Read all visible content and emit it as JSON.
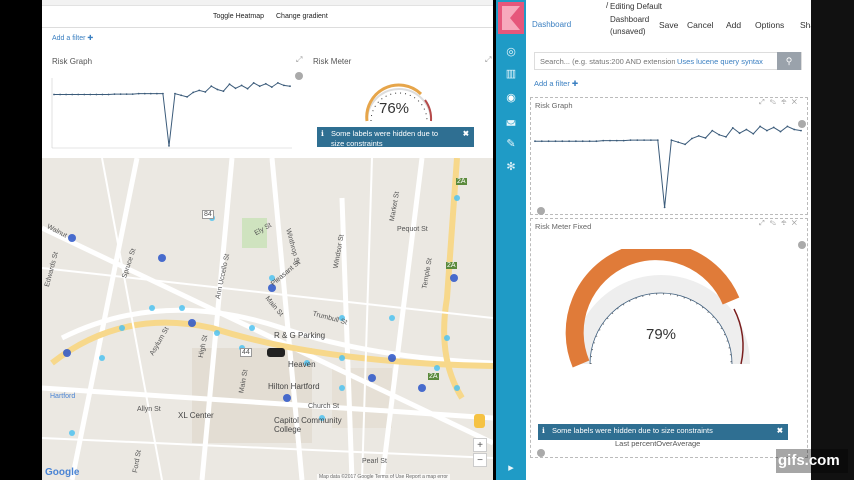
{
  "left_window": {
    "toolbar": {
      "toggle_heatmap": "Toggle Heatmap",
      "change_gradient": "Change gradient"
    },
    "filter_link": "Add a filter ✚",
    "risk_graph_title": "Risk Graph",
    "risk_meter_title": "Risk Meter",
    "risk_meter_value": "76%",
    "risk_meter_level": 0.76,
    "toast": {
      "icon": "ℹ",
      "text": "Some labels were hidden due to size constraints",
      "close": "✖"
    },
    "map": {
      "labels": [
        "Walnut",
        "Edwards St",
        "Ely St",
        "Pleasant St",
        "Main St",
        "Winthrop St",
        "Windsor St",
        "Market St",
        "Pequot St",
        "Trumbull St",
        "R & G Parking",
        "Heaven",
        "Hilton Hartford",
        "Hartford",
        "Allyn St",
        "XL Center",
        "Church St",
        "Capitol Community College",
        "Pearl St",
        "Ford St",
        "Temple St",
        "High St",
        "Ann Uccello St",
        "Asylum St",
        "Spruce St",
        "Main St"
      ],
      "route_shields": [
        "84",
        "44",
        "2A",
        "2A",
        "2A"
      ],
      "attribution": "Map data ©2017 Google   Terms of Use   Report a map error",
      "google": "Google",
      "zoom_in": "+",
      "zoom_out": "−"
    }
  },
  "right_window": {
    "nav": {
      "icons": [
        "kibana-logo",
        "discover-icon",
        "visualize-icon",
        "dashboard-icon",
        "timelion-icon",
        "devtools-icon",
        "settings-icon",
        "collapse-icon"
      ]
    },
    "breadcrumb": {
      "link": "Dashboard",
      "separator": "/",
      "title": "Editing Default Dashboard (unsaved)"
    },
    "actions": {
      "save": "Save",
      "cancel": "Cancel",
      "add": "Add",
      "options": "Options",
      "share": "Share"
    },
    "query": {
      "placeholder": "Search... (e.g. status:200 AND extension:PHP)",
      "hint": "Uses lucene query syntax"
    },
    "filter_link": "Add a filter ✚",
    "risk_graph_title": "Risk Graph",
    "risk_meter_title": "Risk Meter Fixed",
    "risk_meter_value": "79%",
    "risk_meter_level": 0.79,
    "risk_meter_sublabel": "Last percentOverAverage",
    "toast": {
      "icon": "ℹ",
      "text": "Some labels were hidden due to size constraints",
      "close": "✖"
    }
  },
  "watermark": "gifs.com",
  "colors": {
    "kibana_blue": "#1f9bc6",
    "kibana_pink": "#e6567b",
    "gauge_orange": "#e07b39",
    "link_blue": "#3a7fc1",
    "toast_blue": "#2f6f92"
  },
  "chart_data": [
    {
      "type": "line",
      "title": "Risk Graph",
      "x_index": [
        0,
        1,
        2,
        3,
        4,
        5,
        6,
        7,
        8,
        9,
        10,
        11,
        12,
        13,
        14,
        15,
        16,
        17,
        18,
        19,
        20,
        21,
        22,
        23,
        24,
        25,
        26,
        27,
        28,
        29,
        30,
        31,
        32,
        33,
        34,
        35,
        36,
        37,
        38,
        39
      ],
      "values": [
        0.3,
        0.3,
        0.3,
        0.3,
        0.3,
        0.3,
        0.3,
        0.3,
        0.3,
        0.3,
        0.31,
        0.31,
        0.31,
        0.31,
        0.32,
        0.32,
        0.32,
        0.32,
        0.32,
        -0.95,
        0.32,
        0.28,
        0.24,
        0.35,
        0.4,
        0.36,
        0.5,
        0.42,
        0.38,
        0.55,
        0.45,
        0.52,
        0.44,
        0.58,
        0.5,
        0.56,
        0.48,
        0.58,
        0.52,
        0.5
      ]
    }
  ]
}
